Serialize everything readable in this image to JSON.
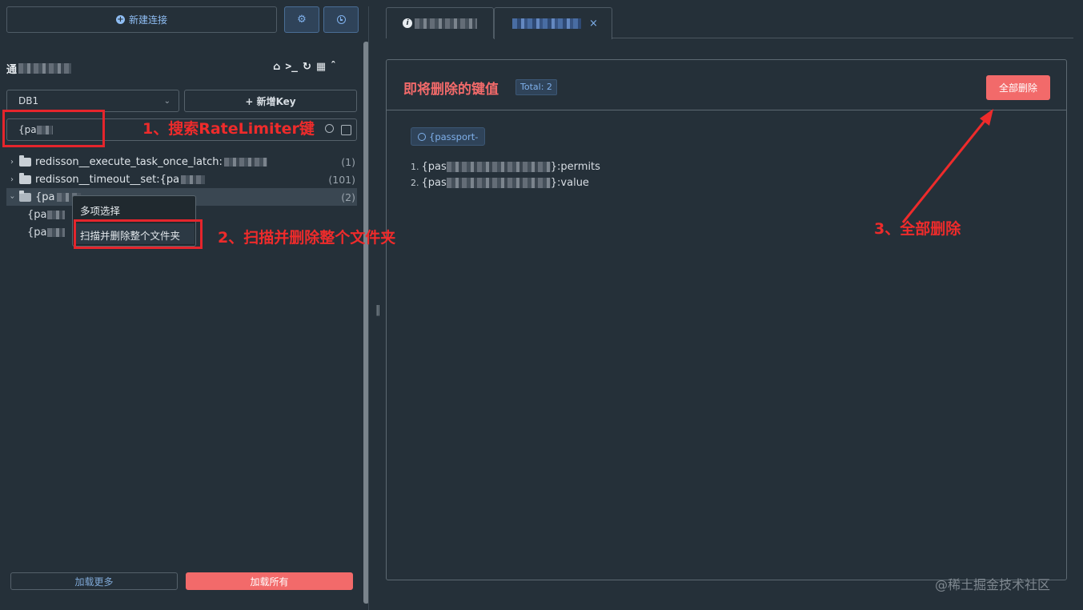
{
  "top": {
    "new_connection": "新建连接",
    "settings_icon": "gear-icon",
    "history_icon": "clock-icon"
  },
  "connection": {
    "name_visible": "通",
    "toolbar_icons": [
      "home-icon",
      "terminal-icon",
      "refresh-icon",
      "grid-icon",
      "chevron-up-icon"
    ]
  },
  "db_select": {
    "value": "DB1"
  },
  "add_key": "+ 新增Key",
  "search": {
    "value": "{pa"
  },
  "tree": [
    {
      "label": "redisson__execute_task_once_latch:",
      "count": "(1)",
      "expanded": false
    },
    {
      "label": "redisson__timeout__set:{pa",
      "count": "(101)",
      "expanded": false
    },
    {
      "label": "{pa",
      "count": "(2)",
      "expanded": true
    }
  ],
  "tree_children": [
    "{pa",
    "{pa"
  ],
  "context_menu": {
    "items": [
      "多项选择",
      "扫描并删除整个文件夹"
    ]
  },
  "bottom": {
    "load_more": "加载更多",
    "load_all": "加载所有"
  },
  "tabs": [
    {
      "prefix_icon": "info-icon",
      "closable": false
    },
    {
      "closable": true,
      "close_glyph": "×"
    }
  ],
  "panel": {
    "title": "即将删除的键值",
    "total": "Total: 2",
    "delete_all": "全部删除",
    "search_tag": "{passport-",
    "keys": [
      {
        "num": "1.",
        "prefix": "{pas",
        "suffix": "}:permits"
      },
      {
        "num": "2.",
        "prefix": "{pas",
        "suffix": "}:value"
      }
    ]
  },
  "annotations": {
    "step1": "1、搜索RateLimiter键",
    "step2": "2、扫描并删除整个文件夹",
    "step3": "3、全部删除"
  },
  "watermark": "@稀土掘金技术社区",
  "colors": {
    "background": "#253039",
    "accent_blue": "#7fb0eb",
    "danger": "#f26a6a",
    "annotation_red": "#ee2b2b"
  }
}
